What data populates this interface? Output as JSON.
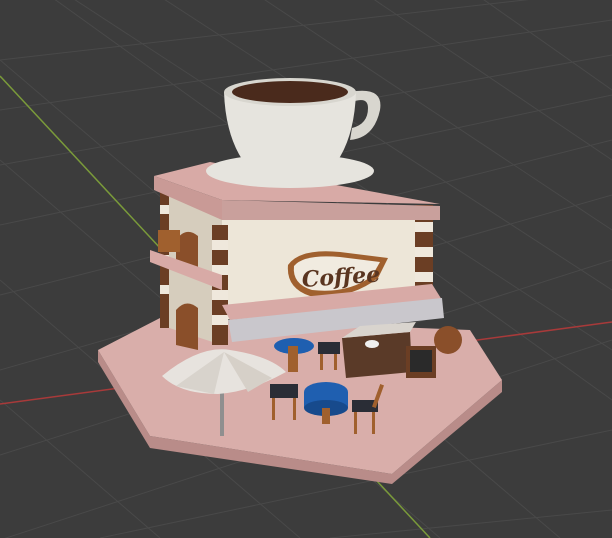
{
  "viewport": {
    "background": "#3c3c3c",
    "grid_color": "#4a4a4a",
    "x_axis_color": "#a83a3a",
    "y_axis_color": "#7a9a3a"
  },
  "scene": {
    "object": "coffee-shop-model",
    "sign_text": "Coffee",
    "colors": {
      "base_pink": "#d9aeaa",
      "roof_pink": "#d8aaa6",
      "wall_cream": "#ede6d8",
      "brown": "#6b3e24",
      "wood": "#a0602e",
      "table_blue": "#1f5fb0",
      "cup_white": "#e6e4de",
      "coffee": "#4a2a1c",
      "umbrella": "#e7e3de",
      "awning": "#c9c7cc"
    }
  }
}
